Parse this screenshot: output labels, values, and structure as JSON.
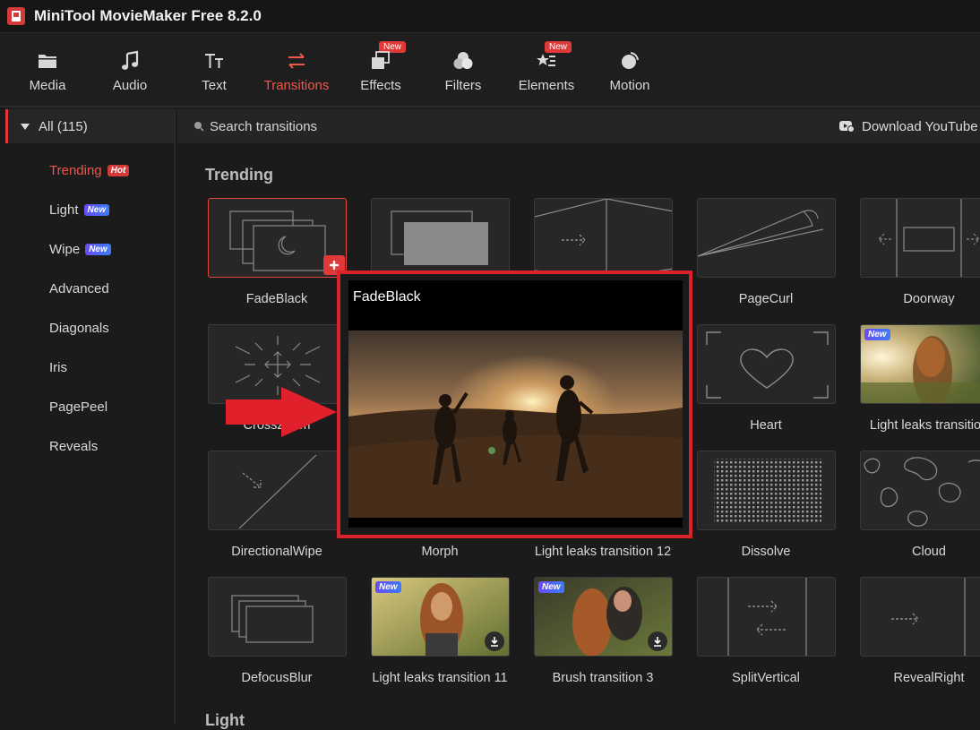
{
  "app": {
    "title": "MiniTool MovieMaker Free 8.2.0",
    "logo_text": ""
  },
  "toolbar": {
    "items": [
      {
        "label": "Media",
        "icon": "folder-icon"
      },
      {
        "label": "Audio",
        "icon": "music-note-icon"
      },
      {
        "label": "Text",
        "icon": "text-icon"
      },
      {
        "label": "Transitions",
        "icon": "swap-arrows-icon"
      },
      {
        "label": "Effects",
        "icon": "layers-icon",
        "badge": "New"
      },
      {
        "label": "Filters",
        "icon": "circles-icon"
      },
      {
        "label": "Elements",
        "icon": "elements-icon",
        "badge": "New"
      },
      {
        "label": "Motion",
        "icon": "motion-icon"
      }
    ],
    "active": "Transitions"
  },
  "sidebar": {
    "all_label": "All (115)",
    "categories": [
      {
        "label": "Trending",
        "tag": "Hot"
      },
      {
        "label": "Light",
        "tag": "New"
      },
      {
        "label": "Wipe",
        "tag": "New"
      },
      {
        "label": "Advanced"
      },
      {
        "label": "Diagonals"
      },
      {
        "label": "Iris"
      },
      {
        "label": "PagePeel"
      },
      {
        "label": "Reveals"
      }
    ]
  },
  "search": {
    "placeholder": "Search transitions",
    "download_label": "Download YouTube V"
  },
  "sections": {
    "trending": "Trending",
    "light": "Light"
  },
  "cards": [
    "FadeBlack",
    "",
    "",
    "PageCurl",
    "Doorway",
    "CrossZoom",
    "",
    "",
    "Heart",
    "Light leaks transition",
    "DirectionalWipe",
    "Morph",
    "Light leaks transition 12",
    "Dissolve",
    "Cloud",
    "DefocusBlur",
    "Light leaks transition 11",
    "Brush transition 3",
    "SplitVertical",
    "RevealRight"
  ],
  "card_new_tag": "New",
  "preview": {
    "title": "FadeBlack"
  },
  "colors": {
    "accent": "#f0564a",
    "annotation": "#d9232a",
    "background": "#1b1b1c"
  }
}
